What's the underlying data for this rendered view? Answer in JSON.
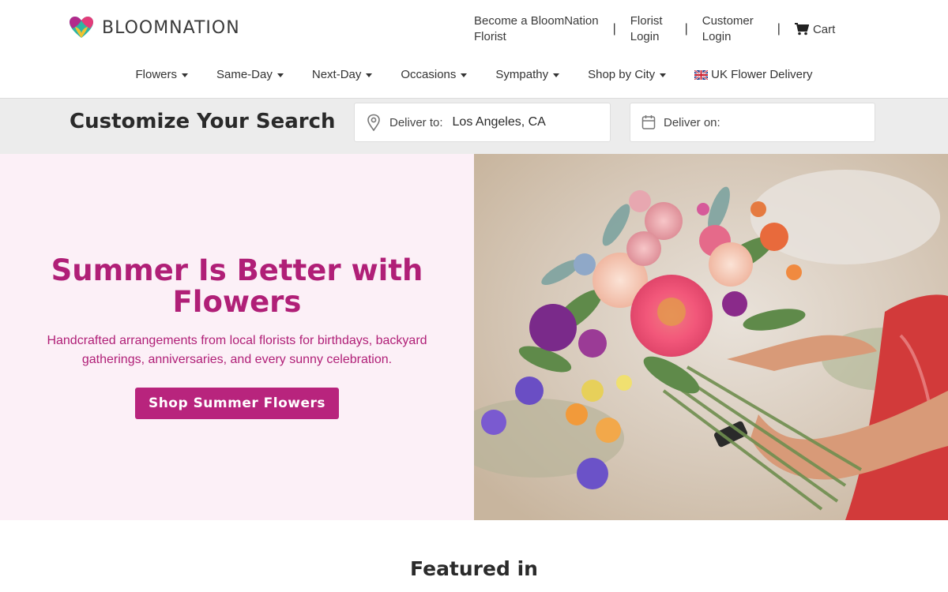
{
  "brand": {
    "name": "BLOOMNATION"
  },
  "top_links": {
    "become_florist": [
      "Become a BloomNation",
      "Florist"
    ],
    "florist_login": [
      "Florist",
      "Login"
    ],
    "customer_login": [
      "Customer",
      "Login"
    ],
    "separator": "|",
    "cart": "Cart"
  },
  "nav": {
    "items": [
      {
        "label": "Flowers"
      },
      {
        "label": "Same-Day"
      },
      {
        "label": "Next-Day"
      },
      {
        "label": "Occasions"
      },
      {
        "label": "Sympathy"
      },
      {
        "label": "Shop by City"
      }
    ],
    "uk": "UK Flower Delivery"
  },
  "search": {
    "title": "Customize Your Search",
    "deliver_to_label": "Deliver to:",
    "deliver_to_value": "Los Angeles, CA",
    "deliver_on_label": "Deliver on:",
    "deliver_on_value": ""
  },
  "hero": {
    "title": "Summer Is Better with Flowers",
    "subtitle": "Handcrafted arrangements from local florists for birthdays, backyard gatherings, anniversaries, and every sunny celebration.",
    "cta": "Shop Summer Flowers"
  },
  "featured": {
    "title": "Featured in"
  },
  "colors": {
    "brand_magenta": "#b01f77",
    "button": "#b8247d",
    "hero_bg": "#fcf0f7",
    "search_bg": "#ececec"
  }
}
